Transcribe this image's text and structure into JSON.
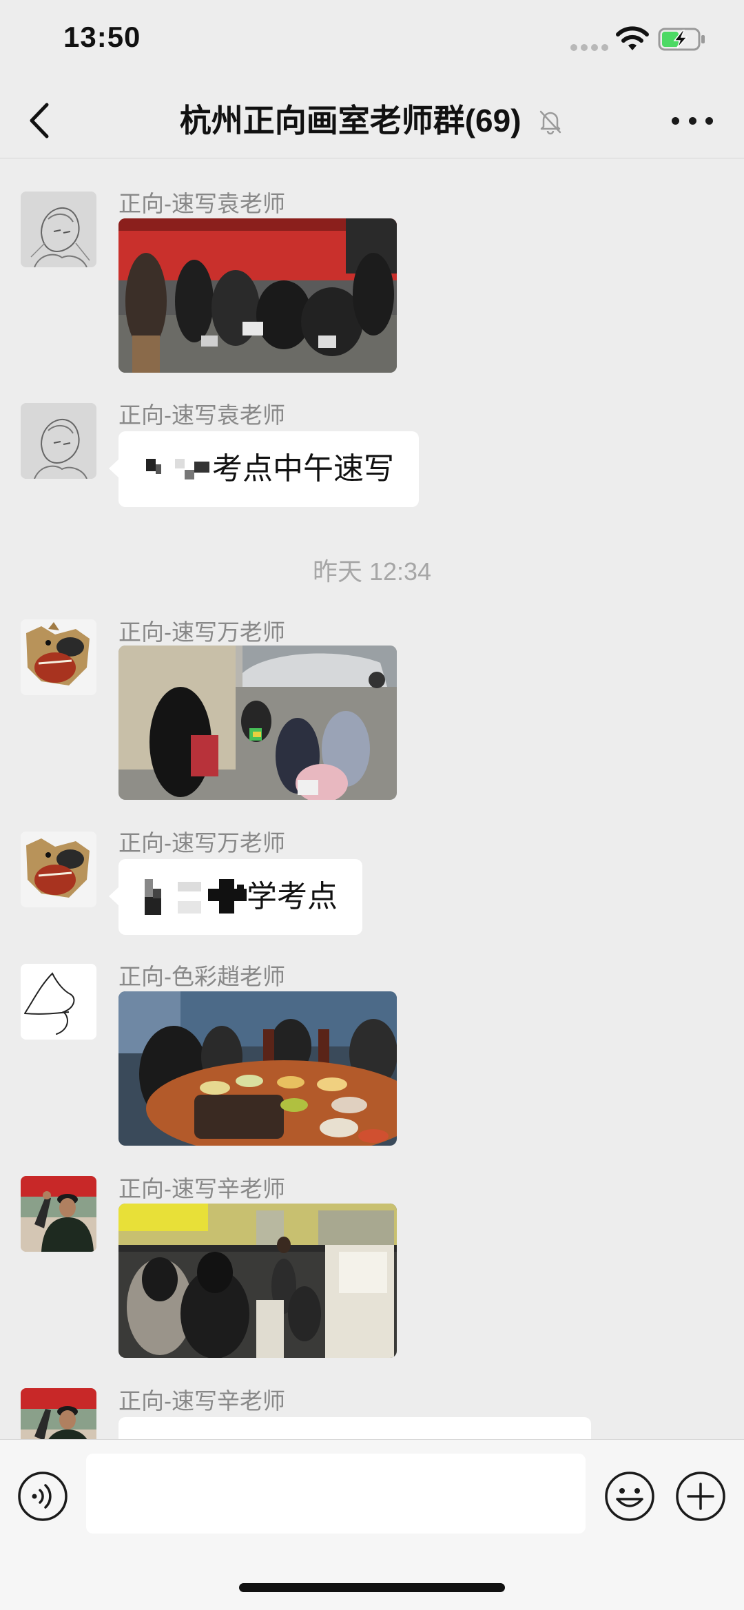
{
  "status_bar": {
    "time": "13:50"
  },
  "nav": {
    "back_icon": "chevron-left-icon",
    "title": "杭州正向画室老师群(69)",
    "mute_icon": "bell-slash-icon",
    "more_icon": "more-horizontal-icon"
  },
  "messages": [
    {
      "sender": "正向-速写袁老师",
      "type": "image",
      "avatar_icon": "sketch-portrait-avatar",
      "image_content": "students-sketching-near-red-bus-photo"
    },
    {
      "sender": "正向-速写袁老师",
      "type": "text",
      "avatar_icon": "sketch-portrait-avatar",
      "text": "考点中午速写"
    },
    {
      "timestamp": "昨天 12:34"
    },
    {
      "sender": "正向-速写万老师",
      "type": "image",
      "avatar_icon": "dog-avatar",
      "image_content": "students-drawing-on-street-photo"
    },
    {
      "sender": "正向-速写万老师",
      "type": "text",
      "avatar_icon": "dog-avatar",
      "text": "学考点"
    },
    {
      "sender": "正向-色彩趙老师",
      "type": "image",
      "avatar_icon": "line-drawing-avatar",
      "image_content": "students-eating-at-round-table-photo"
    },
    {
      "sender": "正向-速写辛老师",
      "type": "image",
      "avatar_icon": "man-in-cap-avatar",
      "image_content": "students-in-bus-photo"
    },
    {
      "sender": "正向-速写辛老师",
      "type": "text",
      "avatar_icon": "man-in-cap-avatar",
      "text": ""
    }
  ],
  "input_bar": {
    "voice_icon": "voice-input-icon",
    "input_value": "",
    "emoji_icon": "emoji-icon",
    "plus_icon": "plus-circle-icon"
  },
  "colors": {
    "background": "#ededed",
    "bubble": "#ffffff",
    "sender_text": "#888888",
    "timestamp_text": "#a6a6a6",
    "battery_green": "#4cd964"
  }
}
